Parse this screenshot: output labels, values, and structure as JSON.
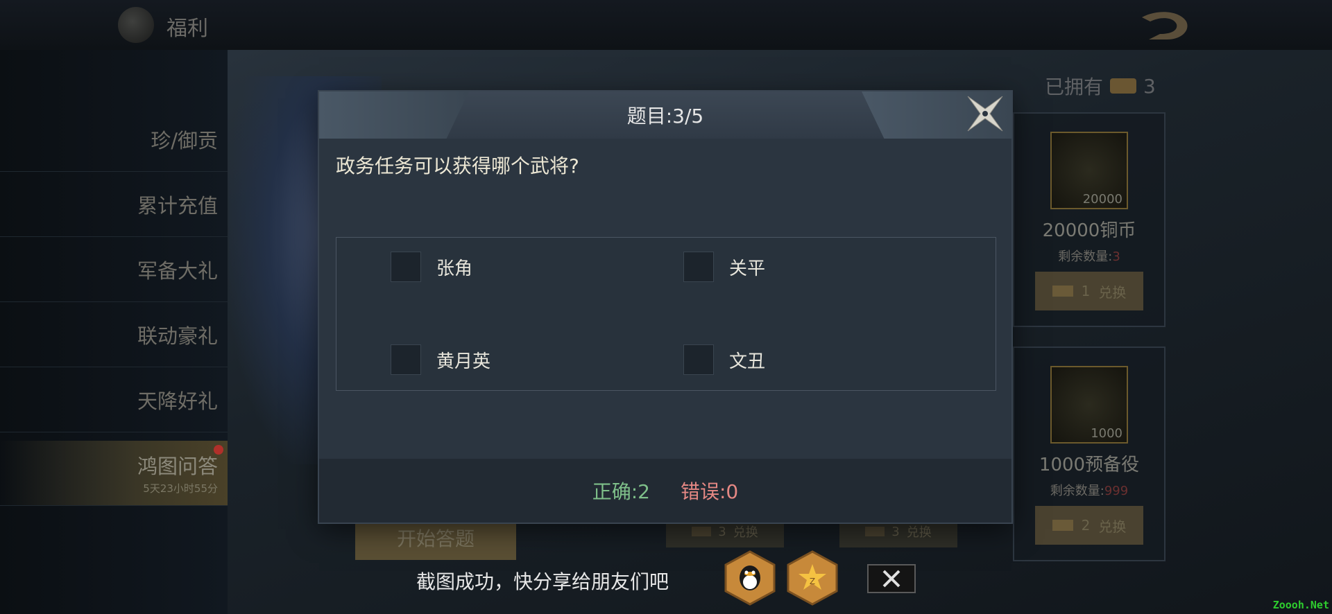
{
  "header": {
    "title": "福利"
  },
  "sidebar": {
    "items": [
      {
        "label": "珍/御贡"
      },
      {
        "label": "累计充值"
      },
      {
        "label": "军备大礼"
      },
      {
        "label": "联动豪礼"
      },
      {
        "label": "天降好礼"
      },
      {
        "label": "鸿图问答",
        "timer": "5天23小时55分",
        "active": true
      }
    ]
  },
  "owned": {
    "label": "已拥有",
    "count": "3"
  },
  "rewards": [
    {
      "qty": "20000",
      "name": "20000铜币",
      "remain_label": "剩余数量:",
      "remain_value": "3",
      "cost": "1",
      "button": "兑换"
    },
    {
      "qty": "1000",
      "name": "1000预备役",
      "remain_label": "剩余数量:",
      "remain_value": "999",
      "cost": "2",
      "button": "兑换"
    }
  ],
  "bottom_exchange": [
    {
      "cost": "3",
      "button": "兑换"
    },
    {
      "cost": "3",
      "button": "兑换"
    }
  ],
  "start_button": "开始答题",
  "quiz": {
    "title": "题目:3/5",
    "question": "政务任务可以获得哪个武将?",
    "options": [
      "张角",
      "关平",
      "黄月英",
      "文丑"
    ],
    "correct": "正确:2",
    "wrong": "错误:0"
  },
  "share": {
    "text": "截图成功，快分享给朋友们吧"
  },
  "watermark": "Zoooh.Net",
  "colors": {
    "correct": "#7fc08a",
    "wrong": "#e58884",
    "share_hex": "#c7893a"
  }
}
